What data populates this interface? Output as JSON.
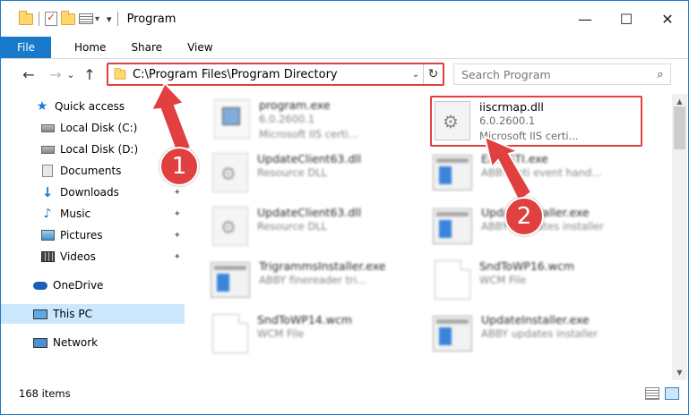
{
  "titlebar": {
    "title": "Program",
    "minimize": "—",
    "maximize": "☐",
    "close": "✕"
  },
  "ribbon": {
    "tabs": [
      "File",
      "Home",
      "Share",
      "View"
    ]
  },
  "nav": {
    "back": "←",
    "forward": "→",
    "recent": "⌄",
    "up": "↑",
    "address": "C:\\Program Files\\Program Directory",
    "refresh": "↻",
    "search_placeholder": "Search Program",
    "search_icon": "⌕"
  },
  "sidebar": {
    "items": [
      {
        "label": "Quick access",
        "icon": "star-icon"
      },
      {
        "label": "Local Disk (C:)",
        "icon": "drive-icon",
        "pinned": true
      },
      {
        "label": "Local Disk (D:)",
        "icon": "drive-icon"
      },
      {
        "label": "Documents",
        "icon": "documents-icon",
        "pinned": true
      },
      {
        "label": "Downloads",
        "icon": "downloads-icon",
        "pinned": true
      },
      {
        "label": "Music",
        "icon": "music-icon",
        "pinned": true
      },
      {
        "label": "Pictures",
        "icon": "pictures-icon",
        "pinned": true
      },
      {
        "label": "Videos",
        "icon": "videos-icon",
        "pinned": true
      },
      {
        "label": "OneDrive",
        "icon": "onedrive-icon"
      },
      {
        "label": "This PC",
        "icon": "computer-icon",
        "selected": true
      },
      {
        "label": "Network",
        "icon": "network-icon"
      }
    ],
    "pin_glyph": "📌"
  },
  "files": [
    {
      "name": "program.exe",
      "line2": "6.0.2600.1",
      "line3": "Microsoft IIS certi...",
      "icon": "app-icon",
      "blurred": true
    },
    {
      "name": "iiscrmap.dll",
      "line2": "6.0.2600.1",
      "line3": "Microsoft IIS certi...",
      "icon": "dll-icon",
      "blurred": false,
      "highlighted": true
    },
    {
      "name": "UpdateClient63.dll",
      "line2": "Resource DLL",
      "line3": "",
      "icon": "dll-icon",
      "blurred": true
    },
    {
      "name": "EasySTI.exe",
      "line2": "ABBYY sti event hand...",
      "line3": "",
      "icon": "app-icon",
      "blurred": true
    },
    {
      "name": "UpdateClient63.dll",
      "line2": "Resource DLL",
      "line3": "",
      "icon": "dll-icon",
      "blurred": true
    },
    {
      "name": "UpdateInstaller.exe",
      "line2": "ABBYY updates installer",
      "line3": "",
      "icon": "app-icon",
      "blurred": true
    },
    {
      "name": "TrigrammsInstaller.exe",
      "line2": "ABBY finereader tri...",
      "line3": "",
      "icon": "app-icon",
      "blurred": true
    },
    {
      "name": "SndToWP16.wcm",
      "line2": "WCM File",
      "line3": "",
      "icon": "file-icon",
      "blurred": true
    },
    {
      "name": "SndToWP14.wcm",
      "line2": "WCM File",
      "line3": "",
      "icon": "file-icon",
      "blurred": true
    },
    {
      "name": "UpdateInstaller.exe",
      "line2": "ABBY updates installer",
      "line3": "",
      "icon": "app-icon",
      "blurred": true
    }
  ],
  "annotations": {
    "step1": "1",
    "step2": "2",
    "color": "#e04040"
  },
  "status": {
    "count": "168 items"
  },
  "colors": {
    "accent": "#1979ca",
    "selected": "#cce8ff",
    "highlight": "#e04040"
  }
}
